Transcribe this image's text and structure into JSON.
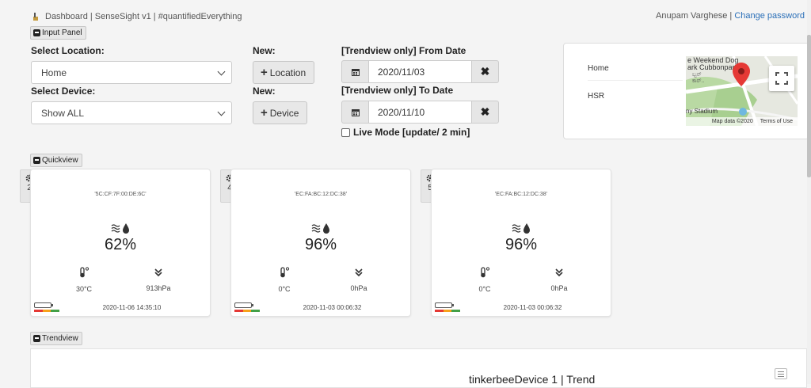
{
  "header": {
    "title": "Dashboard | SenseSight v1 | #quantifiedEverything",
    "user": "Anupam Varghese",
    "separator": "|",
    "change_password": "Change password"
  },
  "sections": {
    "input_panel": "Input Panel",
    "quickview": "Quickview",
    "trendview": "Trendview"
  },
  "form": {
    "location_label": "Select Location:",
    "location_value": "Home",
    "device_label": "Select Device:",
    "device_value": "Show ALL",
    "new_label_1": "New:",
    "new_label_2": "New:",
    "new_location_btn": "Location",
    "new_device_btn": "Device",
    "from_label": "[Trendview only] From Date",
    "from_value": "2020/11/03",
    "to_label": "[Trendview only] To Date",
    "to_value": "2020/11/10",
    "live_mode": "Live Mode [update/ 2 min]",
    "live_mode_checked": false
  },
  "map": {
    "locations": [
      "Home",
      "HSR"
    ],
    "labels": [
      "e Weekend Dog",
      "ark Cubbonpark",
      "ಬ್ಬನ್",
      "ಕಾರ್..",
      "ny Stadium"
    ],
    "footer_data": "Map data ©2020",
    "footer_terms": "Terms of Use"
  },
  "cards": [
    {
      "id": "2",
      "mac": "'5C:CF:7F:00:DE:6C'",
      "humidity": "62%",
      "temperature": "30°C",
      "pressure": "913hPa",
      "timestamp": "2020-11-06 14:35:10"
    },
    {
      "id": "4",
      "mac": "'EC:FA:BC:12:DC:38'",
      "humidity": "96%",
      "temperature": "0°C",
      "pressure": "0hPa",
      "timestamp": "2020-11-03 00:06:32"
    },
    {
      "id": "5",
      "mac": "'EC:FA:BC:12:DC:38'",
      "humidity": "96%",
      "temperature": "0°C",
      "pressure": "0hPa",
      "timestamp": "2020-11-03 00:06:32"
    }
  ],
  "trend": {
    "title": "tinkerbeeDevice 1 | Trend"
  },
  "colors": {
    "link": "#2a6fb8",
    "map_pin": "#e53935",
    "battery_bar": [
      "#e53935",
      "#f7a21b",
      "#43a047"
    ]
  }
}
